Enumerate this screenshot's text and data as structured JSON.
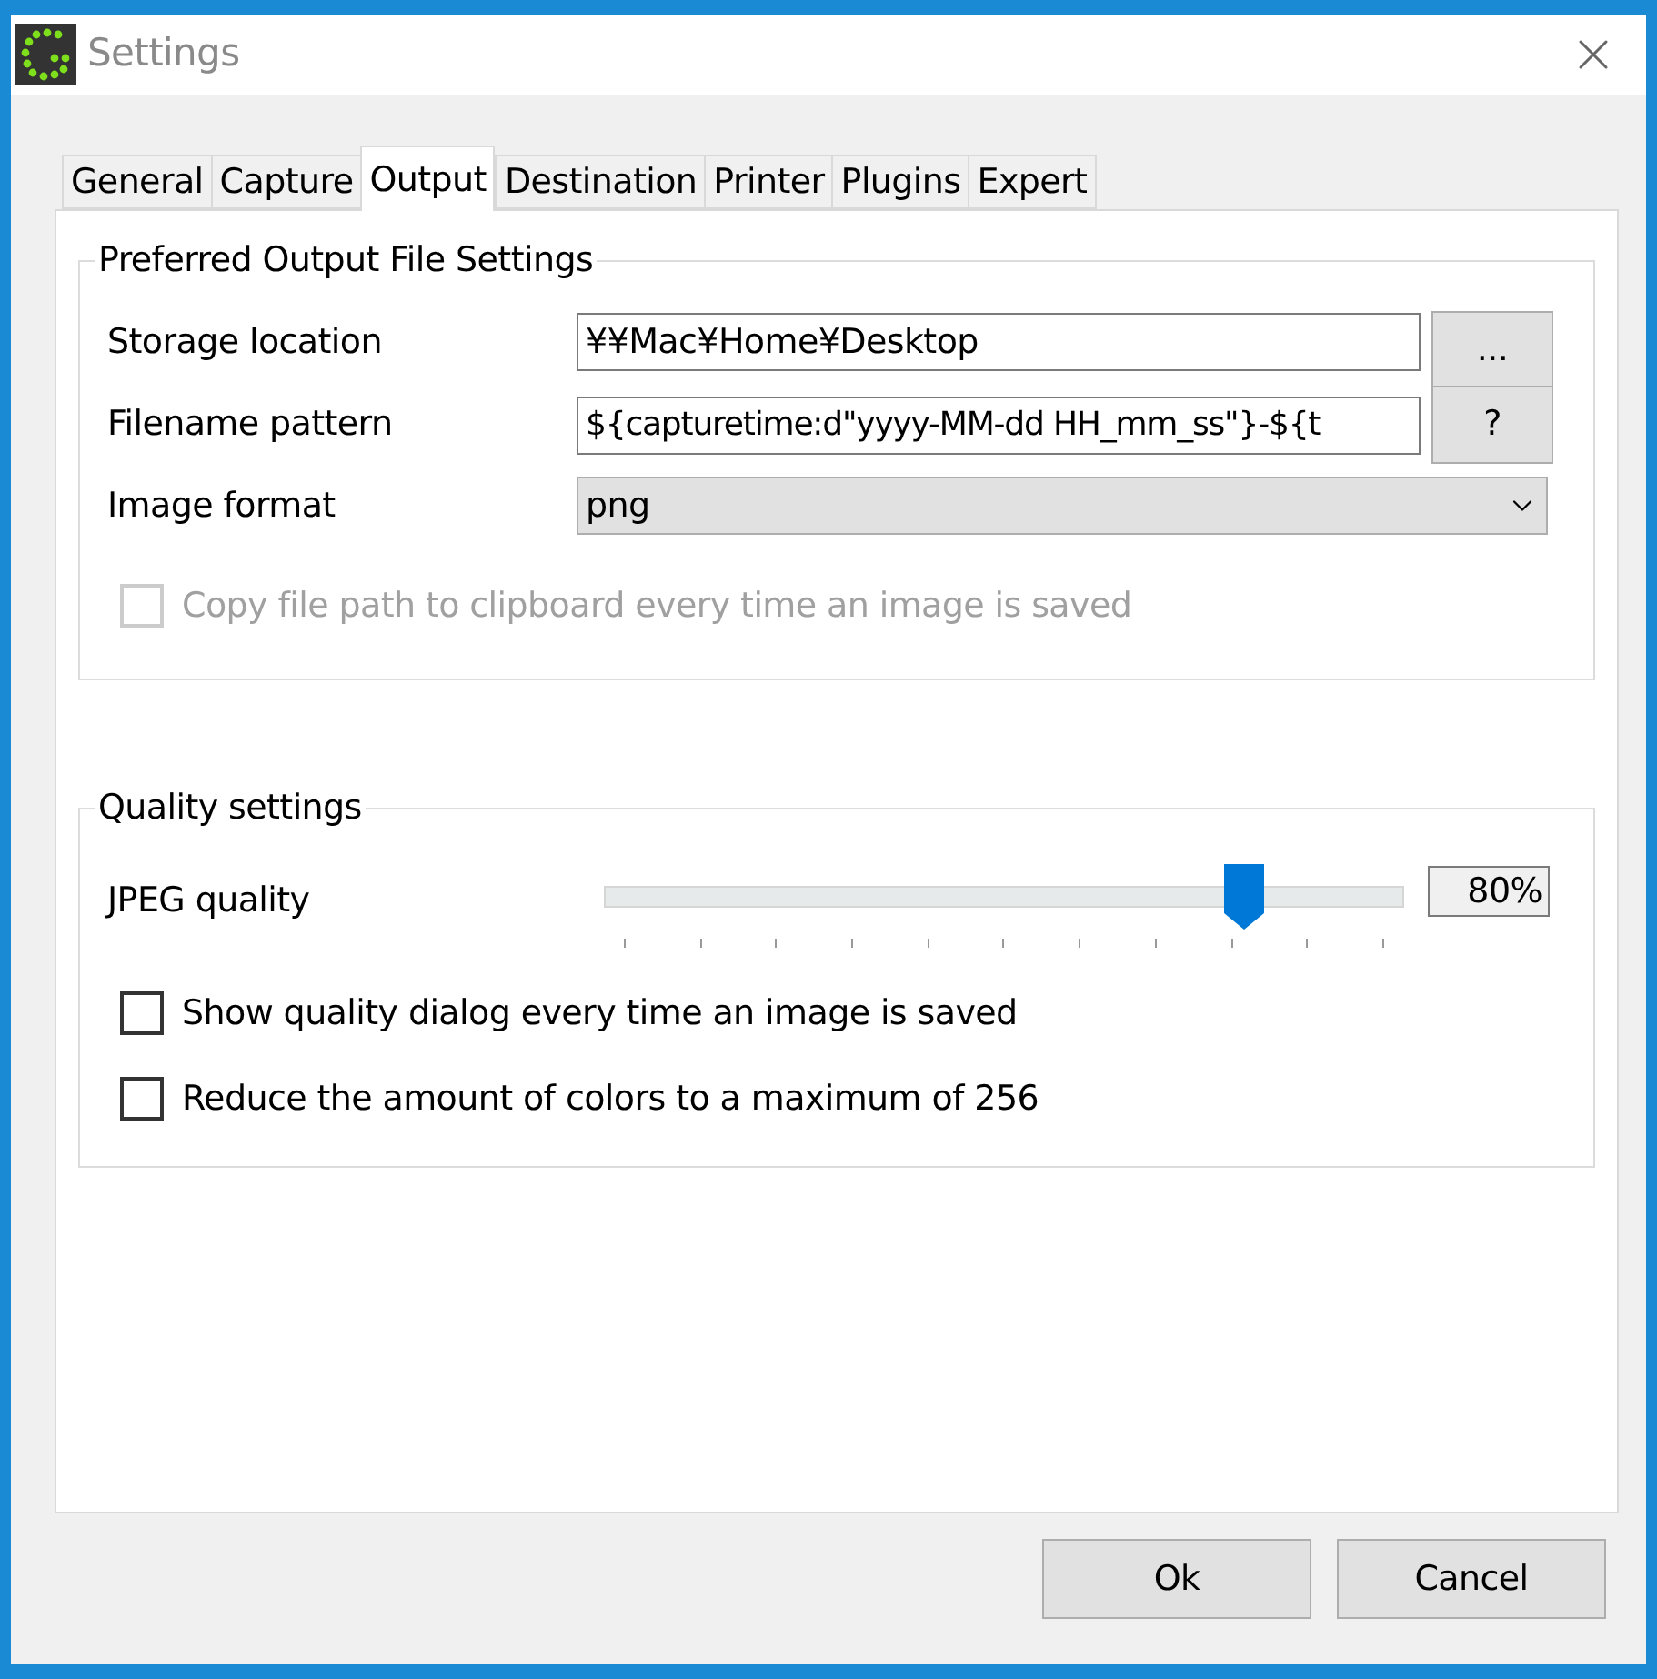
{
  "window": {
    "title": "Settings"
  },
  "tabs": [
    {
      "label": "General",
      "selected": false
    },
    {
      "label": "Capture",
      "selected": false
    },
    {
      "label": "Output",
      "selected": true
    },
    {
      "label": "Destination",
      "selected": false
    },
    {
      "label": "Printer",
      "selected": false
    },
    {
      "label": "Plugins",
      "selected": false
    },
    {
      "label": "Expert",
      "selected": false
    }
  ],
  "output_group": {
    "title": "Preferred Output File Settings",
    "storage_location": {
      "label": "Storage location",
      "value": "¥¥Mac¥Home¥Desktop",
      "button": "..."
    },
    "filename_pattern": {
      "label": "Filename pattern",
      "value": "${capturetime:d\"yyyy-MM-dd HH_mm_ss\"}-${t",
      "button": "?"
    },
    "image_format": {
      "label": "Image format",
      "value": "png"
    },
    "copy_path": {
      "label": "Copy file path to clipboard every time an image is saved",
      "checked": false,
      "disabled": true
    }
  },
  "quality_group": {
    "title": "Quality settings",
    "jpeg_quality": {
      "label": "JPEG quality",
      "level": 0.8,
      "reading": "80%"
    },
    "options": [
      {
        "label": "Show quality dialog every time an image is saved",
        "checked": false,
        "disabled": false
      },
      {
        "label": "Reduce the amount of colors to a maximum of 256",
        "checked": false,
        "disabled": false
      }
    ]
  },
  "buttons": [
    "Ok",
    "Cancel"
  ]
}
